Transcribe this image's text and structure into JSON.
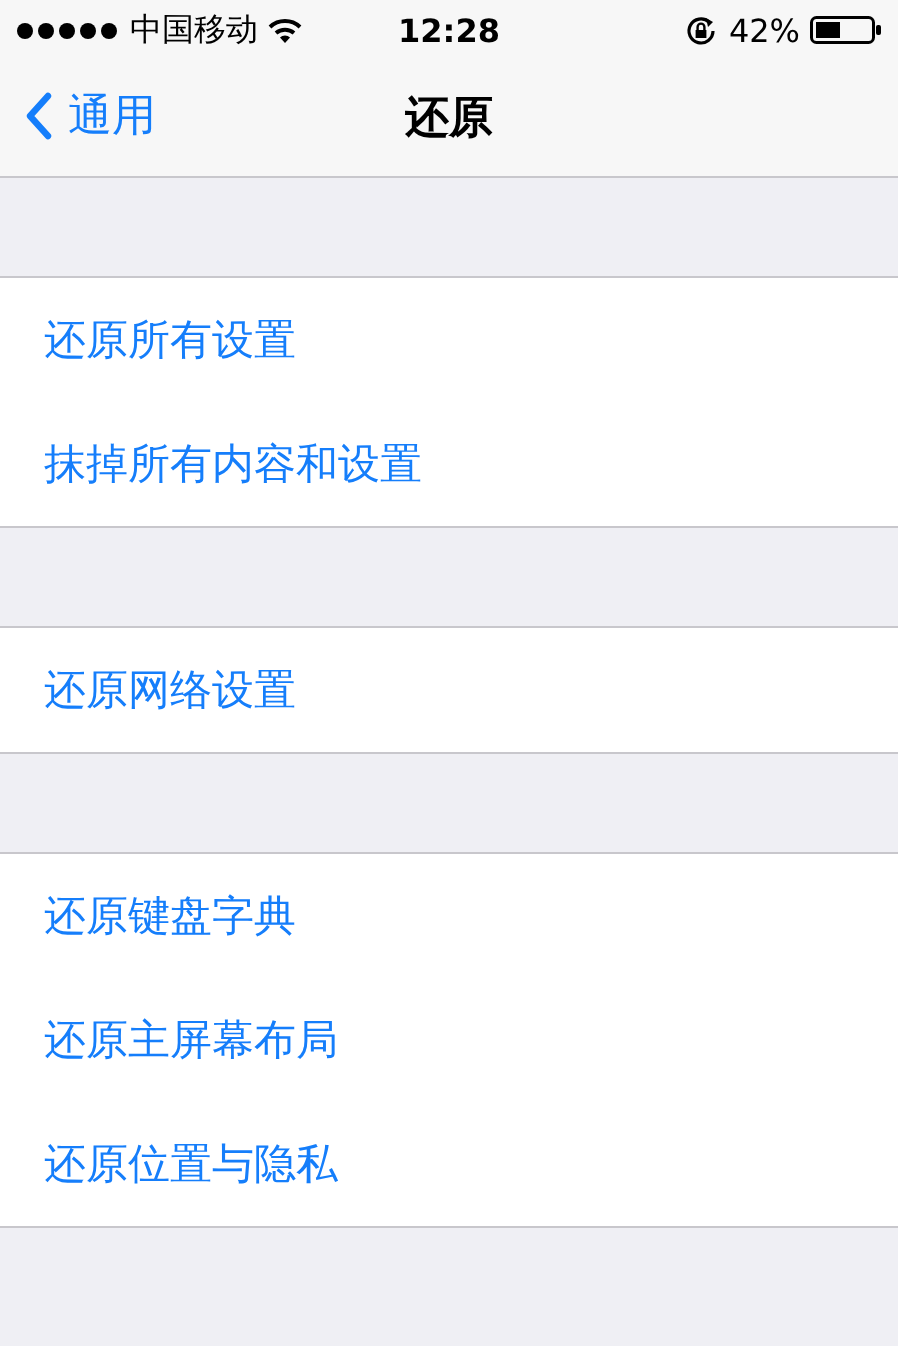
{
  "status_bar": {
    "carrier": "中国移动",
    "time": "12:28",
    "battery": "42%"
  },
  "nav": {
    "back": "通用",
    "title": "还原"
  },
  "groups": [
    {
      "items": [
        "还原所有设置",
        "抹掉所有内容和设置"
      ]
    },
    {
      "items": [
        "还原网络设置"
      ]
    },
    {
      "items": [
        "还原键盘字典",
        "还原主屏幕布局",
        "还原位置与隐私"
      ]
    }
  ]
}
